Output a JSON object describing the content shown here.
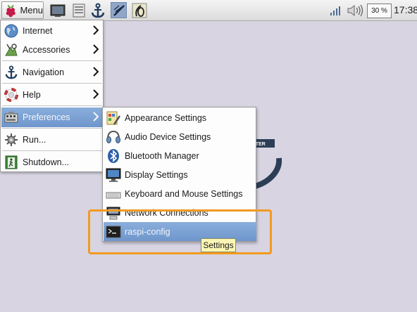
{
  "taskbar": {
    "menu_label": "Menu",
    "cpu_text": "30 %",
    "clock": "17:38",
    "launchers": [
      "file-manager-icon",
      "terminal-icon",
      "navigation-anchor-icon",
      "paintbrush-icon",
      "plotter-icon"
    ]
  },
  "main_menu": {
    "items": [
      {
        "label": "Internet",
        "icon": "globe-icon",
        "submenu": true
      },
      {
        "label": "Accessories",
        "icon": "accessories-icon",
        "submenu": true
      },
      {
        "label": "Navigation",
        "icon": "anchor-icon",
        "submenu": true
      },
      {
        "label": "Help",
        "icon": "lifebuoy-icon",
        "submenu": true
      },
      {
        "label": "Preferences",
        "icon": "preferences-icon",
        "submenu": true,
        "active": true
      },
      {
        "label": "Run...",
        "icon": "run-icon",
        "submenu": false
      },
      {
        "label": "Shutdown...",
        "icon": "exit-icon",
        "submenu": false
      }
    ]
  },
  "preferences_menu": {
    "items": [
      {
        "label": "Appearance Settings",
        "icon": "appearance-icon"
      },
      {
        "label": "Audio Device Settings",
        "icon": "audio-device-icon"
      },
      {
        "label": "Bluetooth Manager",
        "icon": "bluetooth-icon"
      },
      {
        "label": "Display Settings",
        "icon": "display-icon"
      },
      {
        "label": "Keyboard and Mouse Settings",
        "icon": "keyboard-icon"
      },
      {
        "label": "Network Connections",
        "icon": "network-icon"
      },
      {
        "label": "raspi-config",
        "icon": "terminal-icon",
        "active": true
      }
    ]
  },
  "tooltip": "Settings",
  "colors": {
    "highlight_box": "#f29a1f",
    "menu_active": "#7a9fd3",
    "desktop": "#d8d4e2",
    "tooltip_bg": "#fbf6b5"
  }
}
